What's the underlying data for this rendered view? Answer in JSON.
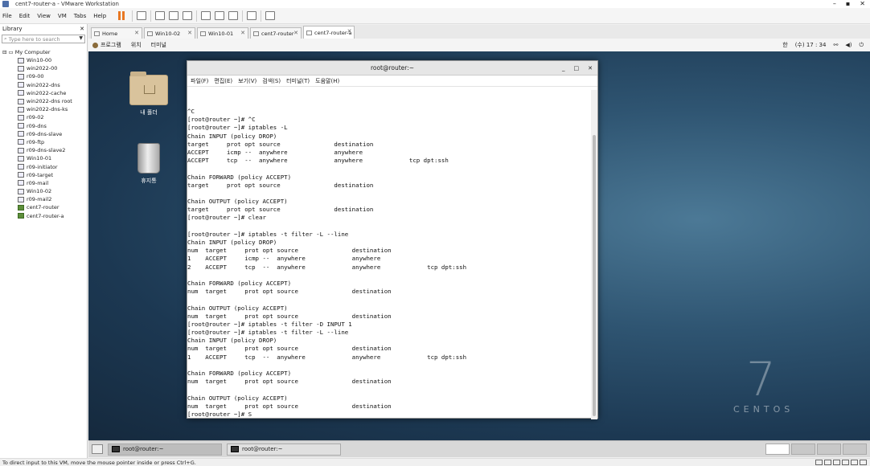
{
  "window": {
    "title": "cent7-router-a - VMware Workstation",
    "controls": [
      "–",
      "▪",
      "✕"
    ]
  },
  "menubar": {
    "items": [
      "File",
      "Edit",
      "View",
      "VM",
      "Tabs",
      "Help"
    ]
  },
  "library": {
    "title": "Library",
    "close": "✕",
    "search_placeholder": "Type here to search",
    "root": "My Computer",
    "items": [
      "Win10-00",
      "win2022-00",
      "r09-00",
      "win2022-dns",
      "win2022-cache",
      "win2022-dns root",
      "win2022-dns-ks",
      "r09-02",
      "r09-dns",
      "r09-dns-slave",
      "r09-ftp",
      "r09-dns-slave2",
      "Win10-01",
      "r09-initiator",
      "r09-target",
      "r09-mail",
      "Win10-02",
      "r09-mail2",
      "cent7-router",
      "cent7-router-a"
    ]
  },
  "tabs": [
    {
      "label": "Home"
    },
    {
      "label": "Win10-02"
    },
    {
      "label": "Win10-01"
    },
    {
      "label": "cent7-router"
    },
    {
      "label": "cent7-router-a"
    }
  ],
  "gnome": {
    "menus": [
      "프로그램",
      "위치",
      "터미널"
    ],
    "lang": "한",
    "clock": "(수) 17 : 34"
  },
  "desktop": {
    "icons": [
      {
        "label": "내 폴더"
      },
      {
        "label": "휴지통"
      }
    ],
    "centos_seven": "7",
    "centos_word": "CENTOS"
  },
  "terminal": {
    "title": "root@router:~",
    "controls": [
      "_",
      "□",
      "✕"
    ],
    "menu": [
      "파일(F)",
      "편집(E)",
      "보기(V)",
      "검색(S)",
      "터미널(T)",
      "도움말(H)"
    ],
    "text": "^C\n[root@router ~]# ^C\n[root@router ~]# iptables -L\nChain INPUT (policy DROP)\ntarget     prot opt source               destination\nACCEPT     icmp --  anywhere             anywhere\nACCEPT     tcp  --  anywhere             anywhere             tcp dpt:ssh\n\nChain FORWARD (policy ACCEPT)\ntarget     prot opt source               destination\n\nChain OUTPUT (policy ACCEPT)\ntarget     prot opt source               destination\n[root@router ~]# clear\n\n[root@router ~]# iptables -t filter -L --line\nChain INPUT (policy DROP)\nnum  target     prot opt source               destination\n1    ACCEPT     icmp --  anywhere             anywhere\n2    ACCEPT     tcp  --  anywhere             anywhere             tcp dpt:ssh\n\nChain FORWARD (policy ACCEPT)\nnum  target     prot opt source               destination\n\nChain OUTPUT (policy ACCEPT)\nnum  target     prot opt source               destination\n[root@router ~]# iptables -t filter -D INPUT 1\n[root@router ~]# iptables -t filter -L --line\nChain INPUT (policy DROP)\nnum  target     prot opt source               destination\n1    ACCEPT     tcp  --  anywhere             anywhere             tcp dpt:ssh\n\nChain FORWARD (policy ACCEPT)\nnum  target     prot opt source               destination\n\nChain OUTPUT (policy ACCEPT)\nnum  target     prot opt source               destination\n[root@router ~]# S"
  },
  "taskbar": {
    "tasks": [
      "root@router:~",
      "root@router:~"
    ]
  },
  "statusbar": {
    "text": "To direct input to this VM, move the mouse pointer inside or press Ctrl+G."
  }
}
